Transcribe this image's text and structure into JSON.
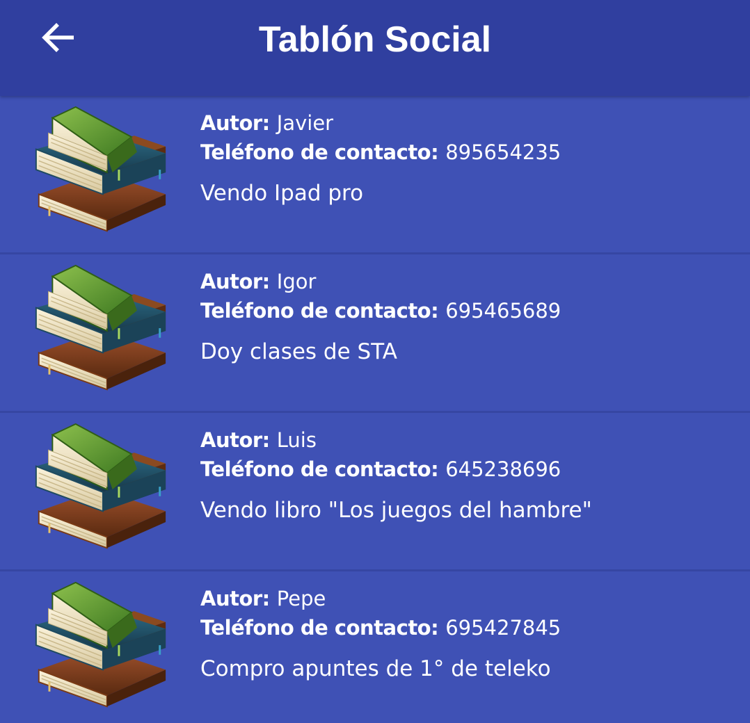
{
  "toolbar": {
    "title": "Tablón Social",
    "back_icon": "arrow-back-icon"
  },
  "labels": {
    "author": "Autor:",
    "phone": "Teléfono de contacto:"
  },
  "posts": [
    {
      "author": "Javier",
      "phone": "895654235",
      "message": "Vendo Ipad pro",
      "icon": "books-icon"
    },
    {
      "author": "Igor",
      "phone": "695465689",
      "message": "Doy clases de STA",
      "icon": "books-icon"
    },
    {
      "author": "Luis",
      "phone": "645238696",
      "message": "Vendo libro \"Los juegos del hambre\"",
      "icon": "books-icon"
    },
    {
      "author": "Pepe",
      "phone": "695427845",
      "message": "Compro apuntes de 1° de teleko",
      "icon": "books-icon"
    }
  ],
  "colors": {
    "toolbar": "#303f9f",
    "background": "#3f51b5",
    "text": "#ffffff"
  }
}
